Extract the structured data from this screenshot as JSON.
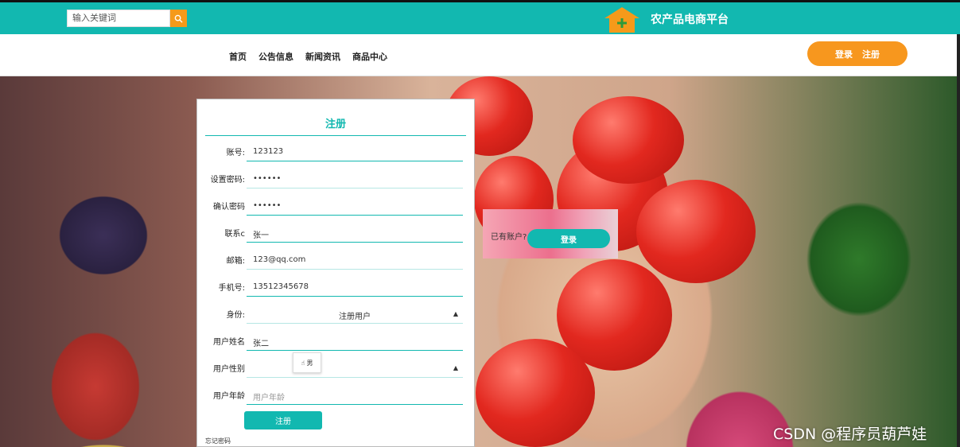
{
  "header": {
    "search_placeholder": "输入关键词",
    "site_title": "农产品电商平台",
    "search_icon": "search-icon",
    "logo_icon": "house-plus-icon"
  },
  "nav": {
    "items": [
      "首页",
      "公告信息",
      "新闻资讯",
      "商品中心"
    ],
    "login_label": "登录",
    "register_label": "注册"
  },
  "register_form": {
    "title": "注册",
    "fields": [
      {
        "label": "账号:",
        "value": "123123"
      },
      {
        "label": "设置密码:",
        "value": "••••••"
      },
      {
        "label": "确认密码",
        "value": "••••••"
      },
      {
        "label": "联系c",
        "value": "张一"
      },
      {
        "label": "邮箱:",
        "value": "123@qq.com"
      },
      {
        "label": "手机号:",
        "value": "13512345678"
      },
      {
        "label": "身份:",
        "value": "注册用户"
      },
      {
        "label": "用户姓名",
        "value": "张二"
      },
      {
        "label": "用户性别",
        "value": ""
      },
      {
        "label": "用户年龄",
        "placeholder": "用户年龄"
      }
    ],
    "submit_label": "注册",
    "forgot_label": "忘记密码",
    "cursor_tip": "男"
  },
  "login_panel": {
    "question": "已有账户?",
    "button_label": "登录"
  },
  "watermark": "CSDN @程序员葫芦娃",
  "colors": {
    "teal": "#12b8b0",
    "orange": "#f7971e"
  }
}
